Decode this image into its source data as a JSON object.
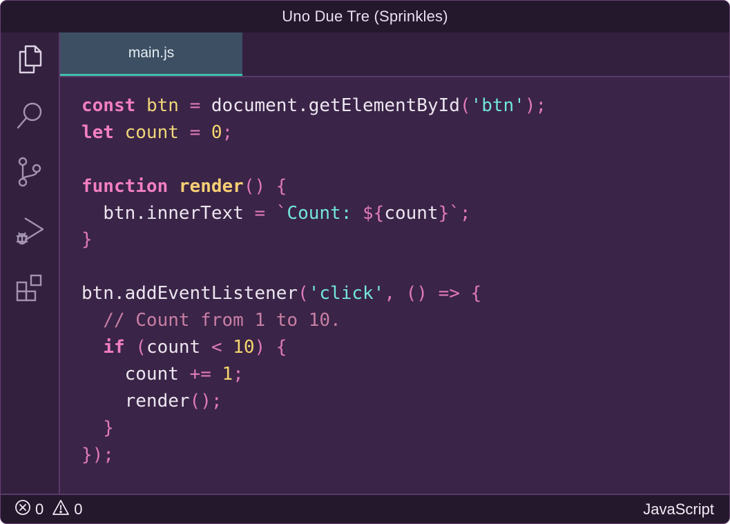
{
  "window": {
    "title": "Uno Due Tre (Sprinkles)"
  },
  "activity_bar": {
    "items": [
      {
        "icon": "files-icon"
      },
      {
        "icon": "search-icon"
      },
      {
        "icon": "source-control-icon"
      },
      {
        "icon": "run-debug-icon"
      },
      {
        "icon": "extensions-icon"
      }
    ]
  },
  "tabs": [
    {
      "label": "main.js",
      "active": true
    }
  ],
  "editor": {
    "language": "JavaScript",
    "lines": [
      [
        {
          "t": "kw",
          "v": "const"
        },
        {
          "t": "plain",
          "v": " "
        },
        {
          "t": "var",
          "v": "btn"
        },
        {
          "t": "plain",
          "v": " "
        },
        {
          "t": "op",
          "v": "="
        },
        {
          "t": "plain",
          "v": " document.getElementById"
        },
        {
          "t": "op",
          "v": "("
        },
        {
          "t": "str",
          "v": "'btn'"
        },
        {
          "t": "op",
          "v": ");"
        }
      ],
      [
        {
          "t": "kw",
          "v": "let"
        },
        {
          "t": "plain",
          "v": " "
        },
        {
          "t": "var",
          "v": "count"
        },
        {
          "t": "plain",
          "v": " "
        },
        {
          "t": "op",
          "v": "="
        },
        {
          "t": "plain",
          "v": " "
        },
        {
          "t": "num",
          "v": "0"
        },
        {
          "t": "op",
          "v": ";"
        }
      ],
      [],
      [
        {
          "t": "kw",
          "v": "function"
        },
        {
          "t": "plain",
          "v": " "
        },
        {
          "t": "fn",
          "v": "render"
        },
        {
          "t": "op",
          "v": "() {"
        }
      ],
      [
        {
          "t": "plain",
          "v": "  btn.innerText "
        },
        {
          "t": "op",
          "v": "="
        },
        {
          "t": "plain",
          "v": " "
        },
        {
          "t": "tmpl",
          "v": "`"
        },
        {
          "t": "str",
          "v": "Count: "
        },
        {
          "t": "tmpl",
          "v": "${"
        },
        {
          "t": "plain",
          "v": "count"
        },
        {
          "t": "tmpl",
          "v": "}`"
        },
        {
          "t": "op",
          "v": ";"
        }
      ],
      [
        {
          "t": "op",
          "v": "}"
        }
      ],
      [],
      [
        {
          "t": "plain",
          "v": "btn.addEventListener"
        },
        {
          "t": "op",
          "v": "("
        },
        {
          "t": "str",
          "v": "'click'"
        },
        {
          "t": "op",
          "v": ", () => {"
        }
      ],
      [
        {
          "t": "cm",
          "v": "  // Count from 1 to 10."
        }
      ],
      [
        {
          "t": "plain",
          "v": "  "
        },
        {
          "t": "kw",
          "v": "if"
        },
        {
          "t": "plain",
          "v": " "
        },
        {
          "t": "op",
          "v": "("
        },
        {
          "t": "plain",
          "v": "count "
        },
        {
          "t": "op",
          "v": "<"
        },
        {
          "t": "plain",
          "v": " "
        },
        {
          "t": "num",
          "v": "10"
        },
        {
          "t": "op",
          "v": ") {"
        }
      ],
      [
        {
          "t": "plain",
          "v": "    count "
        },
        {
          "t": "op",
          "v": "+="
        },
        {
          "t": "plain",
          "v": " "
        },
        {
          "t": "num",
          "v": "1"
        },
        {
          "t": "op",
          "v": ";"
        }
      ],
      [
        {
          "t": "plain",
          "v": "    render"
        },
        {
          "t": "op",
          "v": "();"
        }
      ],
      [
        {
          "t": "op",
          "v": "  }"
        }
      ],
      [
        {
          "t": "op",
          "v": "});"
        }
      ]
    ]
  },
  "status_bar": {
    "errors": {
      "icon": "error-circle-icon",
      "count": "0"
    },
    "warnings": {
      "icon": "warning-triangle-icon",
      "count": "0"
    },
    "language": "JavaScript"
  },
  "colors": {
    "background": "#3a2447",
    "keyword": "#f27ec3",
    "string": "#73e6d9",
    "number": "#f6d66e",
    "tab_accent": "#3fbfaa"
  }
}
